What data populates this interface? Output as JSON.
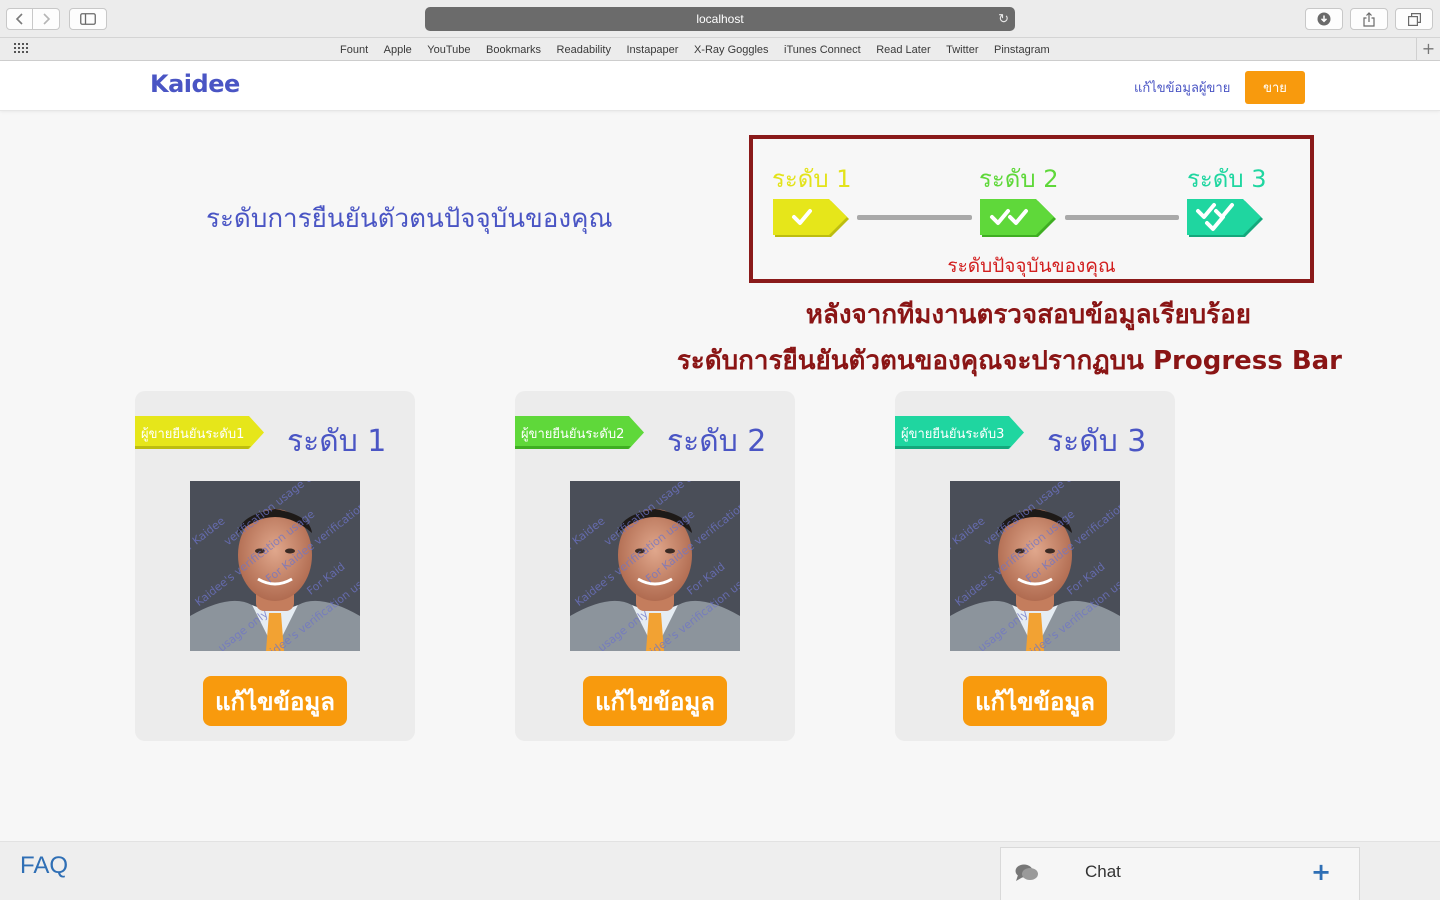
{
  "browser": {
    "address": "localhost",
    "favorites": [
      "Fount",
      "Apple",
      "YouTube",
      "Bookmarks",
      "Readability",
      "Instapaper",
      "X-Ray Goggles",
      "iTunes Connect",
      "Read Later",
      "Twitter",
      "Pinstagram"
    ]
  },
  "header": {
    "logo": "Kaidee",
    "edit_seller": "แก้ไขข้อมูลผู้ขาย",
    "sell_button": "ขาย"
  },
  "main": {
    "title": "ระดับการยืนยันตัวตนปัจจุบันของคุณ",
    "progress": {
      "levels": [
        {
          "label": "ระดับ 1",
          "color": "#e6e61a",
          "checks": 1
        },
        {
          "label": "ระดับ 2",
          "color": "#5fd83a",
          "checks": 2
        },
        {
          "label": "ระดับ 3",
          "color": "#1fd6a0",
          "checks": 3
        }
      ],
      "current_caption": "ระดับปัจจุบันของคุณ",
      "box_color": "#8a1a1a"
    },
    "notice_line1": "หลังจากทีมงานตรวจสอบข้อมูลเรียบร้อย",
    "notice_line2": "ระดับการยืนยันตัวตนของคุณจะปรากฏบน Progress Bar"
  },
  "cards": [
    {
      "ribbon": "ผู้ขายยืนยันระดับ1",
      "ribbon_color": "#e6e61a",
      "level": "ระดับ 1",
      "button": "แก้ไขข้อมูล"
    },
    {
      "ribbon": "ผู้ขายยืนยันระดับ2",
      "ribbon_color": "#5fd83a",
      "level": "ระดับ 2",
      "button": "แก้ไขข้อมูล"
    },
    {
      "ribbon": "ผู้ขายยืนยันระดับ3",
      "ribbon_color": "#1fd6a0",
      "level": "ระดับ 3",
      "button": "แก้ไขข้อมูล"
    }
  ],
  "photo_watermark": [
    "For Kaidee",
    "verification usage only",
    "Kaidee's verification usage",
    "For Kaidee verification",
    "usage only",
    "For Kaid",
    "Kaidee's verification usage only"
  ],
  "footer": {
    "faq": "FAQ",
    "chat_label": "Chat",
    "chat_plus": "+"
  },
  "icons": [
    "back-icon",
    "forward-icon",
    "sidebar-icon",
    "reload-icon",
    "download-icon",
    "share-icon",
    "tabs-icon",
    "grid-icon",
    "check-icon",
    "chat-bubble-icon"
  ]
}
